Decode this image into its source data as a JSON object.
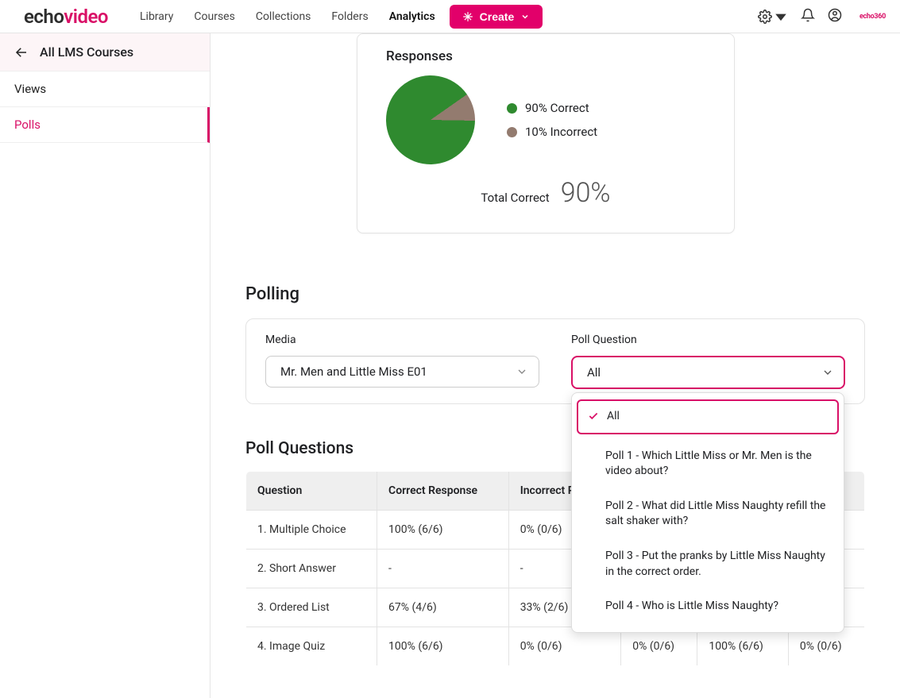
{
  "logo": {
    "part1": "echo",
    "part2": "video"
  },
  "nav": {
    "library": "Library",
    "courses": "Courses",
    "collections": "Collections",
    "folders": "Folders",
    "analytics": "Analytics"
  },
  "create_label": "Create",
  "mini_logo": "echo360",
  "sidebar": {
    "back_label": "All LMS Courses",
    "items": [
      {
        "label": "Views"
      },
      {
        "label": "Polls"
      }
    ]
  },
  "responses_card": {
    "title": "Responses",
    "legend_correct": "90% Correct",
    "legend_incorrect": "10% Incorrect",
    "total_label": "Total Correct",
    "total_pct": "90%"
  },
  "polling": {
    "heading": "Polling",
    "media_label": "Media",
    "media_value": "Mr. Men and Little Miss E01",
    "question_label": "Poll Question",
    "question_value": "All",
    "dropdown": [
      "All",
      "Poll 1 - Which Little Miss or Mr. Men is the video about?",
      "Poll 2 - What did Little Miss Naughty refill the salt shaker with?",
      "Poll 3 - Put the pranks by Little Miss Naughty in the correct order.",
      "Poll 4 - Who is Little Miss Naughty?"
    ]
  },
  "poll_questions": {
    "heading": "Poll Questions",
    "headers": [
      "Question",
      "Correct Response",
      "Incorrect Resp"
    ],
    "rows": [
      {
        "q": "1. Multiple Choice",
        "c": "100% (6/6)",
        "i": "0% (0/6)",
        "extra": [
          "",
          "",
          ""
        ]
      },
      {
        "q": "2. Short Answer",
        "c": "-",
        "i": "-",
        "extra": [
          "",
          "",
          ""
        ]
      },
      {
        "q": "3. Ordered List",
        "c": "67% (4/6)",
        "i": "33% (2/6)",
        "extra": [
          "",
          "",
          ""
        ]
      },
      {
        "q": "4. Image Quiz",
        "c": "100% (6/6)",
        "i": "0% (0/6)",
        "extra": [
          "0% (0/6)",
          "100% (6/6)",
          "0% (0/6)"
        ]
      }
    ]
  },
  "chart_data": {
    "type": "pie",
    "title": "Responses",
    "series": [
      {
        "name": "Correct",
        "value": 90,
        "color": "#2f8a2f"
      },
      {
        "name": "Incorrect",
        "value": 10,
        "color": "#937b6f"
      }
    ],
    "total_correct_pct": 90
  }
}
